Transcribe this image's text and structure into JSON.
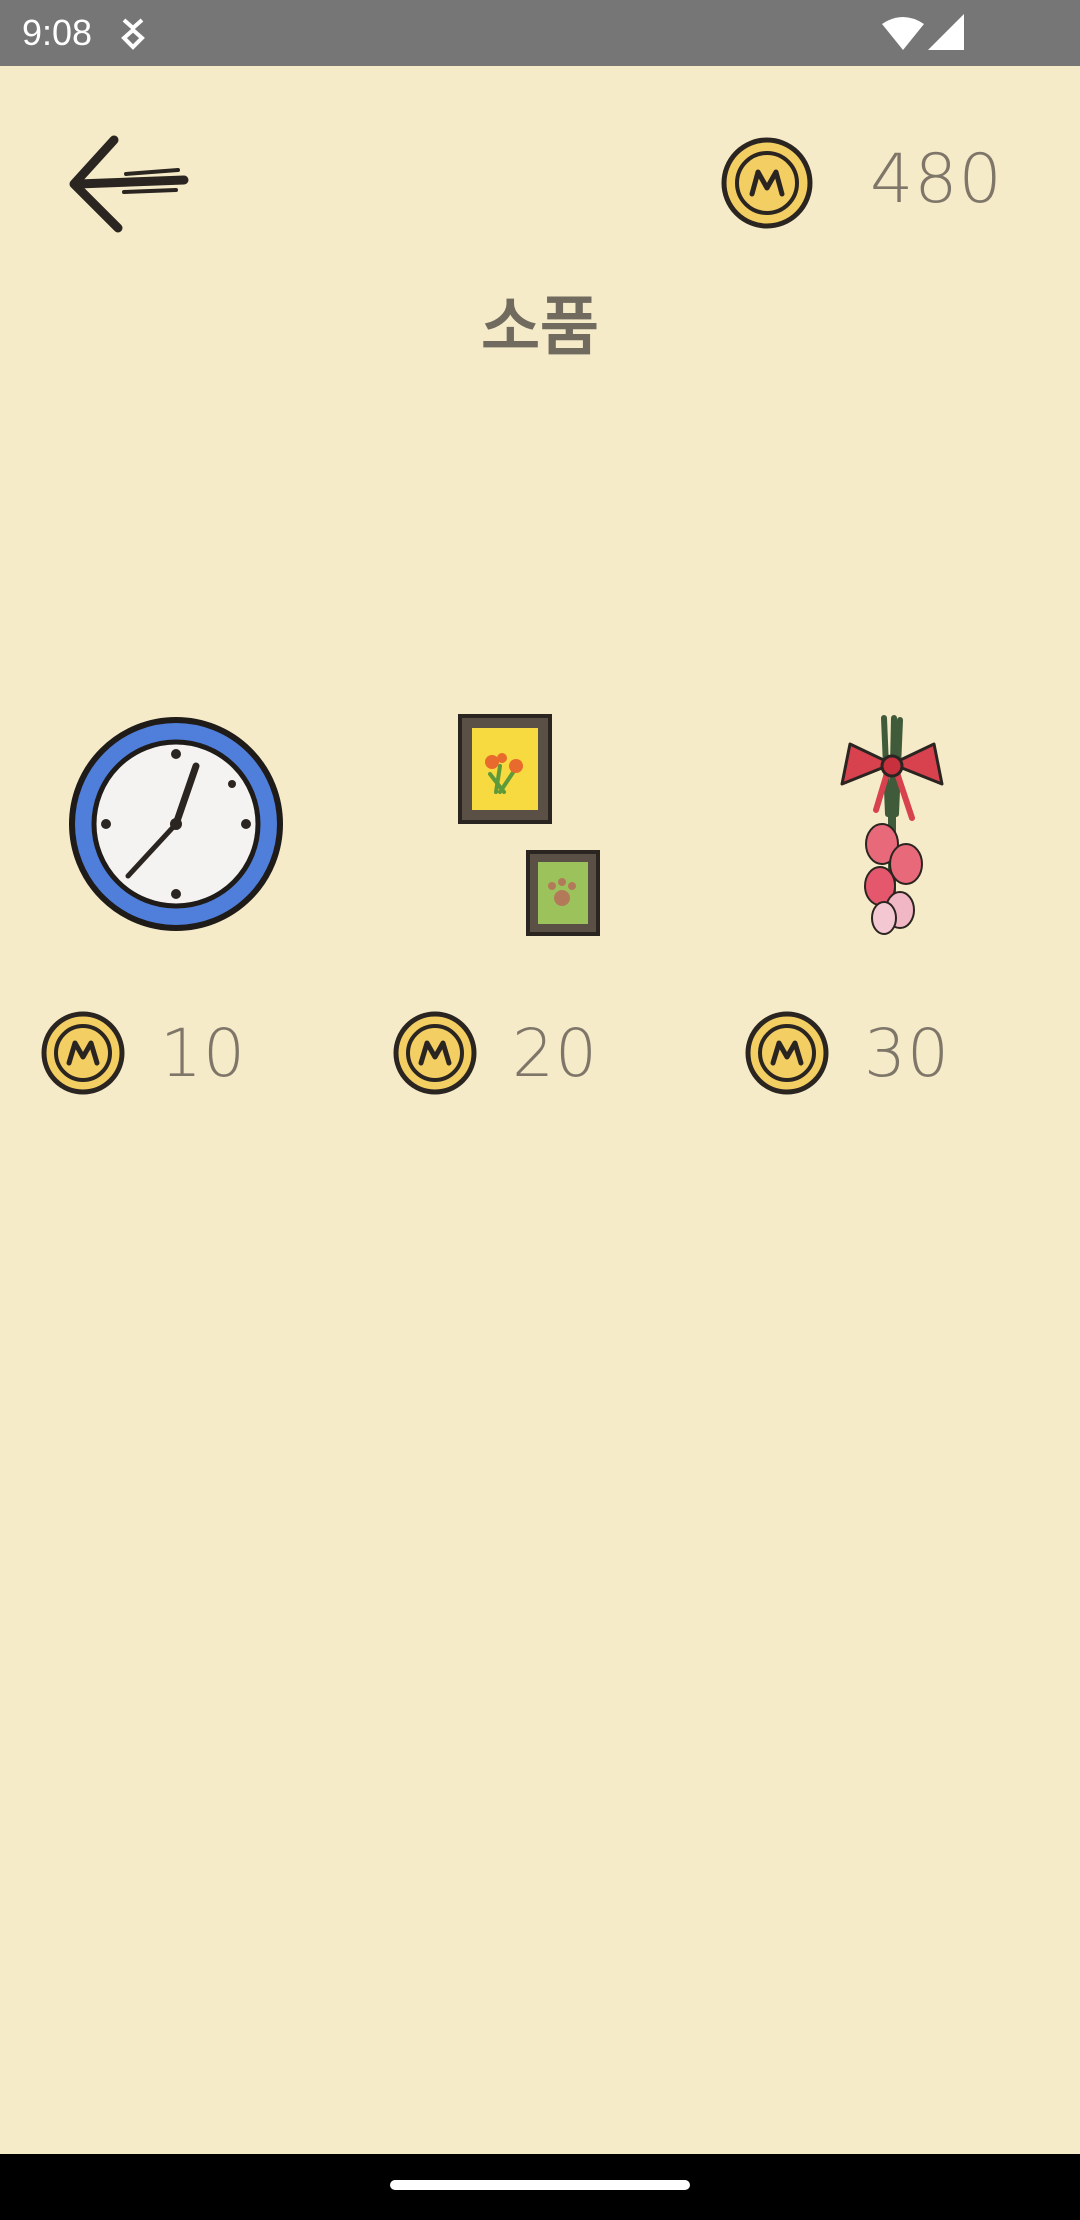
{
  "status_bar": {
    "time": "9:08"
  },
  "header": {
    "coin_balance": "480"
  },
  "page": {
    "title": "소품"
  },
  "products": [
    {
      "name": "clock",
      "price": "10"
    },
    {
      "name": "picture-frames",
      "price": "20"
    },
    {
      "name": "flower-bouquet",
      "price": "30"
    }
  ],
  "colors": {
    "background": "#F6EBC8",
    "coin_gold": "#F3CE63",
    "text_gray": "#7F766A",
    "status_bar": "#767676"
  }
}
